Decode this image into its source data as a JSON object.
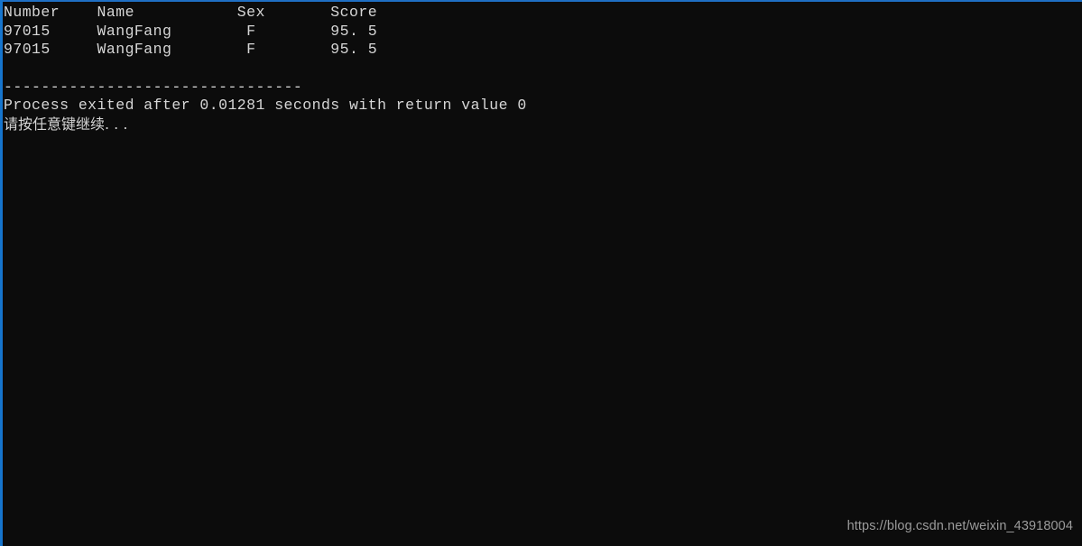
{
  "window": {
    "kind": "windows-console",
    "background_color": "#0c0c0c",
    "text_color": "#d6d6d6",
    "border_color": "#1675cd",
    "top_edge_color": "#1f6fc4"
  },
  "table": {
    "header_line": "Number    Name           Sex       Score",
    "columns": [
      "Number",
      "Name",
      "Sex",
      "Score"
    ],
    "rows": [
      {
        "line": "97015     WangFang        F        95. 5",
        "number": "97015",
        "name": "WangFang",
        "sex": "F",
        "score": "95. 5"
      },
      {
        "line": "97015     WangFang        F        95. 5",
        "number": "97015",
        "name": "WangFang",
        "sex": "F",
        "score": "95. 5"
      }
    ]
  },
  "separator": {
    "line": "--------------------------------"
  },
  "exit_status": {
    "line": "Process exited after 0.01281 seconds with return value 0",
    "seconds": "0.01281",
    "return_value": "0"
  },
  "prompt": {
    "line": "请按任意键继续. . ."
  },
  "watermark": {
    "text": "https://blog.csdn.net/weixin_43918004"
  }
}
